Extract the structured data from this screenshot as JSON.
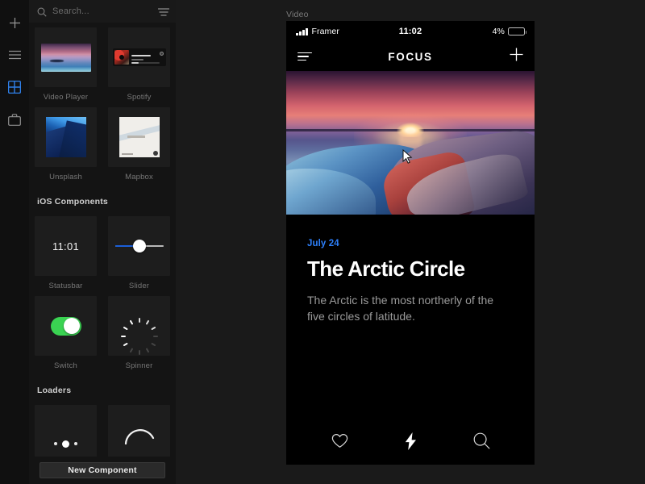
{
  "rail": {
    "items": [
      {
        "name": "add",
        "icon": "plus-icon",
        "active": false
      },
      {
        "name": "layers",
        "icon": "hamburger-icon",
        "active": false
      },
      {
        "name": "components",
        "icon": "grid-icon",
        "active": true
      },
      {
        "name": "assets",
        "icon": "briefcase-icon",
        "active": false
      }
    ],
    "active_color": "#1f6feb"
  },
  "panel": {
    "search": {
      "placeholder": "Search...",
      "value": "",
      "icon": "search-icon",
      "sort_icon": "sort-filter-icon"
    },
    "sections": [
      {
        "title": "",
        "items": [
          {
            "label": "Video Player",
            "art": "video"
          },
          {
            "label": "Spotify",
            "art": "spotify"
          },
          {
            "label": "Unsplash",
            "art": "unsplash"
          },
          {
            "label": "Mapbox",
            "art": "mapbox"
          }
        ]
      },
      {
        "title": "iOS Components",
        "items": [
          {
            "label": "Statusbar",
            "art": "statusbar",
            "value": "11:01"
          },
          {
            "label": "Slider",
            "art": "slider"
          },
          {
            "label": "Switch",
            "art": "switch"
          },
          {
            "label": "Spinner",
            "art": "spinner"
          }
        ]
      },
      {
        "title": "Loaders",
        "items": [
          {
            "label": "",
            "art": "dots"
          },
          {
            "label": "",
            "art": "arc"
          }
        ]
      }
    ],
    "footer_button": "New Component"
  },
  "canvas": {
    "frame_label": "Video",
    "phone": {
      "statusbar": {
        "carrier": "Framer",
        "time": "11:02",
        "battery_percent": "4%",
        "battery_level": 4,
        "battery_color": "#e2342a"
      },
      "header": {
        "title": "FOCUS",
        "menu_icon": "hamburger-icon",
        "add_icon": "plus-icon"
      },
      "hero": {
        "alt": "arctic sunset over icy shore"
      },
      "article": {
        "date": "July 24",
        "date_color": "#2d7ff9",
        "title": "The Arctic Circle",
        "body": "The Arctic is the most northerly of the five circles of latitude."
      },
      "tabs": [
        {
          "name": "favorites",
          "icon": "heart-icon",
          "active": false
        },
        {
          "name": "flash",
          "icon": "lightning-icon",
          "active": true
        },
        {
          "name": "search",
          "icon": "search-icon",
          "active": false
        }
      ]
    }
  }
}
